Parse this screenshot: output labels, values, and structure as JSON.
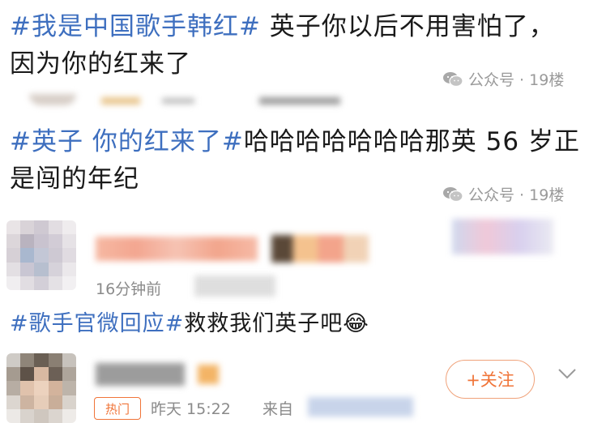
{
  "comments": [
    {
      "tag": "#我是中国歌手韩红#",
      "text_line1": " 英子你以后不用害怕了，",
      "text_line2": "因为你的红来了",
      "source": "公众号",
      "floor": "19楼"
    },
    {
      "tag": "#英子 你的红来了#",
      "text_line1": "哈哈哈哈哈哈哈那英 56 岁正",
      "text_line2": "是闯的年纪",
      "source": "公众号",
      "floor": "19楼"
    }
  ],
  "weibo_post_1": {
    "time": "16分钟前",
    "tag": "#歌手官微回应#",
    "text": "救救我们英子吧",
    "emoji": "😂"
  },
  "weibo_post_2": {
    "follow_label": "+关注",
    "hot_badge": "热门",
    "time": "昨天 15:22",
    "from_label": "来自"
  },
  "colors": {
    "tag_blue": "#3e6fbf",
    "accent_orange": "#f07438",
    "meta_gray": "#9a9a9a"
  }
}
